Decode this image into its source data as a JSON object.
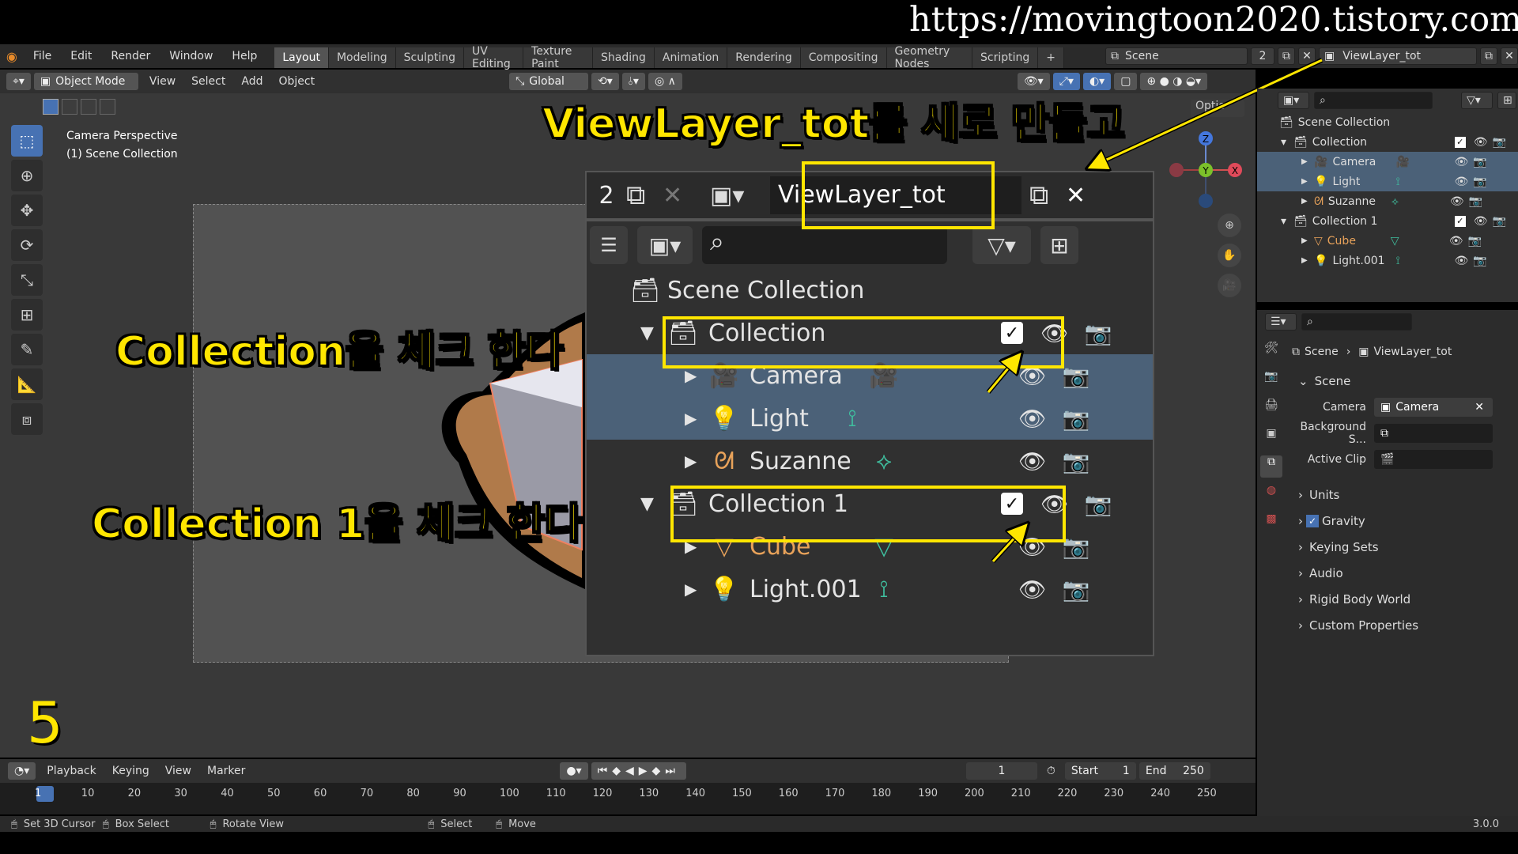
{
  "watermark": "https://movingtoon2020.tistory.com",
  "topbar": {
    "menus": [
      "File",
      "Edit",
      "Render",
      "Window",
      "Help"
    ],
    "workspaces": [
      "Layout",
      "Modeling",
      "Sculpting",
      "UV Editing",
      "Texture Paint",
      "Shading",
      "Animation",
      "Rendering",
      "Compositing",
      "Geometry Nodes",
      "Scripting",
      "+"
    ],
    "active_workspace": "Layout",
    "scene": "Scene",
    "view_layer_count": "2",
    "view_layer": "ViewLayer_tot"
  },
  "viewport_header": {
    "mode": "Object Mode",
    "menus": [
      "View",
      "Select",
      "Add",
      "Object"
    ],
    "transform": "Global",
    "options": "Optio"
  },
  "viewport": {
    "camera_text": "Camera Perspective",
    "collection_text": "(1) Scene Collection",
    "step_number": "5"
  },
  "annotations": {
    "new_viewlayer": "ViewLayer_tot를 새로 만들고",
    "check_collection": "Collection을  체크 한다",
    "check_collection1": "Collection 1을  체크 한다"
  },
  "zoom": {
    "count": "2",
    "view_layer": "ViewLayer_tot",
    "rows": [
      {
        "label": "Scene Collection",
        "icon": "collection-icon"
      },
      {
        "label": "Collection",
        "icon": "collection-icon",
        "checked": true
      },
      {
        "label": "Camera",
        "icon": "camera-icon"
      },
      {
        "label": "Light",
        "icon": "light-icon"
      },
      {
        "label": "Suzanne",
        "icon": "monkey-icon"
      },
      {
        "label": "Collection 1",
        "icon": "collection-icon",
        "checked": true
      },
      {
        "label": "Cube",
        "icon": "mesh-icon"
      },
      {
        "label": "Light.001",
        "icon": "light-icon"
      }
    ]
  },
  "outliner": {
    "rows": [
      {
        "label": "Scene Collection"
      },
      {
        "label": "Collection"
      },
      {
        "label": "Camera"
      },
      {
        "label": "Light"
      },
      {
        "label": "Suzanne"
      },
      {
        "label": "Collection 1"
      },
      {
        "label": "Cube"
      },
      {
        "label": "Light.001"
      }
    ]
  },
  "properties": {
    "breadcrumb_scene": "Scene",
    "breadcrumb_layer": "ViewLayer_tot",
    "section": "Scene",
    "camera_label": "Camera",
    "camera_value": "Camera",
    "background_label": "Background S...",
    "clip_label": "Active Clip",
    "panels": [
      "Units",
      "Gravity",
      "Keying Sets",
      "Audio",
      "Rigid Body World",
      "Custom Properties"
    ]
  },
  "timeline": {
    "menus": [
      "Playback",
      "Keying",
      "View",
      "Marker"
    ],
    "current_frame": "1",
    "start_label": "Start",
    "start": "1",
    "end_label": "End",
    "end": "250",
    "ticks": [
      "1",
      "10",
      "20",
      "30",
      "40",
      "50",
      "60",
      "70",
      "80",
      "90",
      "100",
      "110",
      "120",
      "130",
      "140",
      "150",
      "160",
      "170",
      "180",
      "190",
      "200",
      "210",
      "220",
      "230",
      "240",
      "250"
    ]
  },
  "statusbar": {
    "items": [
      "Set 3D Cursor",
      "Box Select",
      "Rotate View",
      "Select",
      "Move"
    ],
    "version": "3.0.0"
  },
  "colors": {
    "annotation": "#ffe600",
    "selected_row": "#4b6178",
    "active_tool": "#4772b3"
  }
}
